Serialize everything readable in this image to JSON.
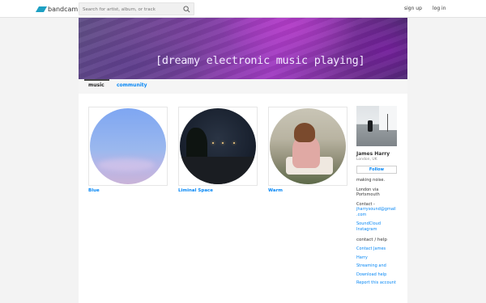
{
  "header": {
    "logo_text": "bandcamp",
    "search_placeholder": "Search for artist, album, or track",
    "signup_label": "sign up",
    "login_label": "log in"
  },
  "banner": {
    "text": "[dreamy electronic music playing]"
  },
  "tabs": {
    "music": "music",
    "community": "community"
  },
  "albums": [
    {
      "title": "Blue"
    },
    {
      "title": "Liminal Space"
    },
    {
      "title": "Warm"
    }
  ],
  "artist": {
    "name": "James Harry",
    "location": "London, UK",
    "follow_label": "Follow",
    "bio": "making noise.",
    "location_line1": "London via",
    "location_line2": "Portsmouth",
    "contact_label": "Contact -",
    "contact_email_1": "jharrysound@gmail",
    "contact_email_2": ".com",
    "link_soundcloud": "SoundCloud",
    "link_instagram": "Instagram"
  },
  "help": {
    "heading": "contact / help",
    "contact_line1": "Contact James",
    "contact_line2": "Harry",
    "streaming_line1": "Streaming and",
    "streaming_line2": "Download help",
    "report": "Report this account"
  },
  "colors": {
    "accent": "#0687f5",
    "logo": "#1da0c3",
    "banner_purple": "#a03cc2"
  },
  "icons": {
    "search": "search-icon",
    "logo": "bandcamp-logo-icon"
  }
}
